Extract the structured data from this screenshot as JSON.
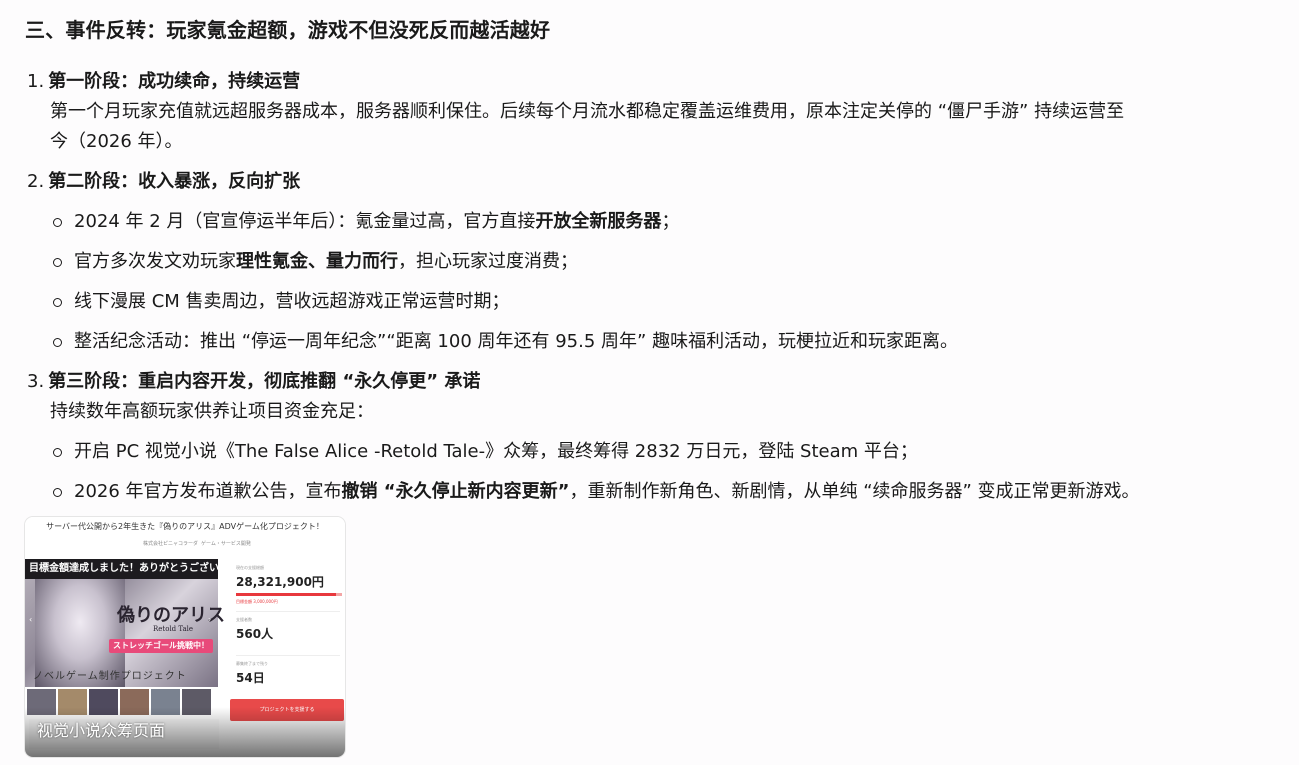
{
  "section": {
    "title": "三、事件反转：玩家氪金超额，游戏不但没死反而越活越好"
  },
  "phase1": {
    "num": "1.",
    "title": "第一阶段：成功续命，持续运营",
    "desc_line1": "第一个月玩家充值就远超服务器成本，服务器顺利保住。后续每个月流水都稳定覆盖运维费用，原本注定关停的 “僵尸手游” 持续运营至",
    "desc_line2": "今（2026 年）。"
  },
  "phase2": {
    "num": "2.",
    "title": "第二阶段：收入暴涨，反向扩张",
    "items": [
      {
        "pre": "2024 年 2 月（官宣停运半年后）：氪金量过高，官方直接",
        "bold": "开放全新服务器",
        "post": "；"
      },
      {
        "pre": "官方多次发文劝玩家",
        "bold": "理性氪金、量力而行",
        "post": "，担心玩家过度消费；"
      },
      {
        "pre": "线下漫展 CM 售卖周边，营收远超游戏正常运营时期；",
        "bold": "",
        "post": ""
      },
      {
        "pre": "整活纪念活动：推出 “停运一周年纪念”“距离 100 周年还有 95.5 周年” 趣味福利活动，玩梗拉近和玩家距离。",
        "bold": "",
        "post": ""
      }
    ]
  },
  "phase3": {
    "num": "3.",
    "title": "第三阶段：重启内容开发，彻底推翻 “永久停更” 承诺",
    "desc": "持续数年高额玩家供养让项目资金充足：",
    "items": [
      {
        "pre": "开启 PC 视觉小说《The False Alice -Retold Tale-》众筹，最终筹得 2832 万日元，登陆 Steam 平台；",
        "bold": "",
        "post": ""
      },
      {
        "pre": "2026 年官方发布道歉公告，宣布",
        "bold": "撤销 “永久停止新内容更新”",
        "post": "，重新制作新角色、新剧情，从单纯 “续命服务器” 变成正常更新游戏。"
      }
    ]
  },
  "image": {
    "caption": "视觉小说众筹页面",
    "page_title": "サーバー代公開から2年生きた『偽りのアリス』ADVゲーム化プロジェクト！",
    "meta_left": "株式会社ピニャコラーダ",
    "meta_right": "ゲーム・サービス開発",
    "banner": "目標金額達成しました！ありがとうございます！",
    "logo_main": "偽りのアリス",
    "logo_sub": "Retold Tale",
    "stretch": "ストレッチゴール挑戦中！",
    "novel": "ノベルゲーム制作プロジェクト",
    "amount_label": "現在の支援総額",
    "amount": "28,321,900円",
    "goal_note": "目標金額 3,000,000円",
    "supporters_label": "支援者数",
    "supporters": "560人",
    "remaining_label": "募集終了まで残り",
    "remaining": "54日",
    "support_button": "プロジェクトを支援する",
    "progress": 0.94
  },
  "colors": {
    "accent_red": "#e8383d",
    "pink": "#e84a7a"
  }
}
